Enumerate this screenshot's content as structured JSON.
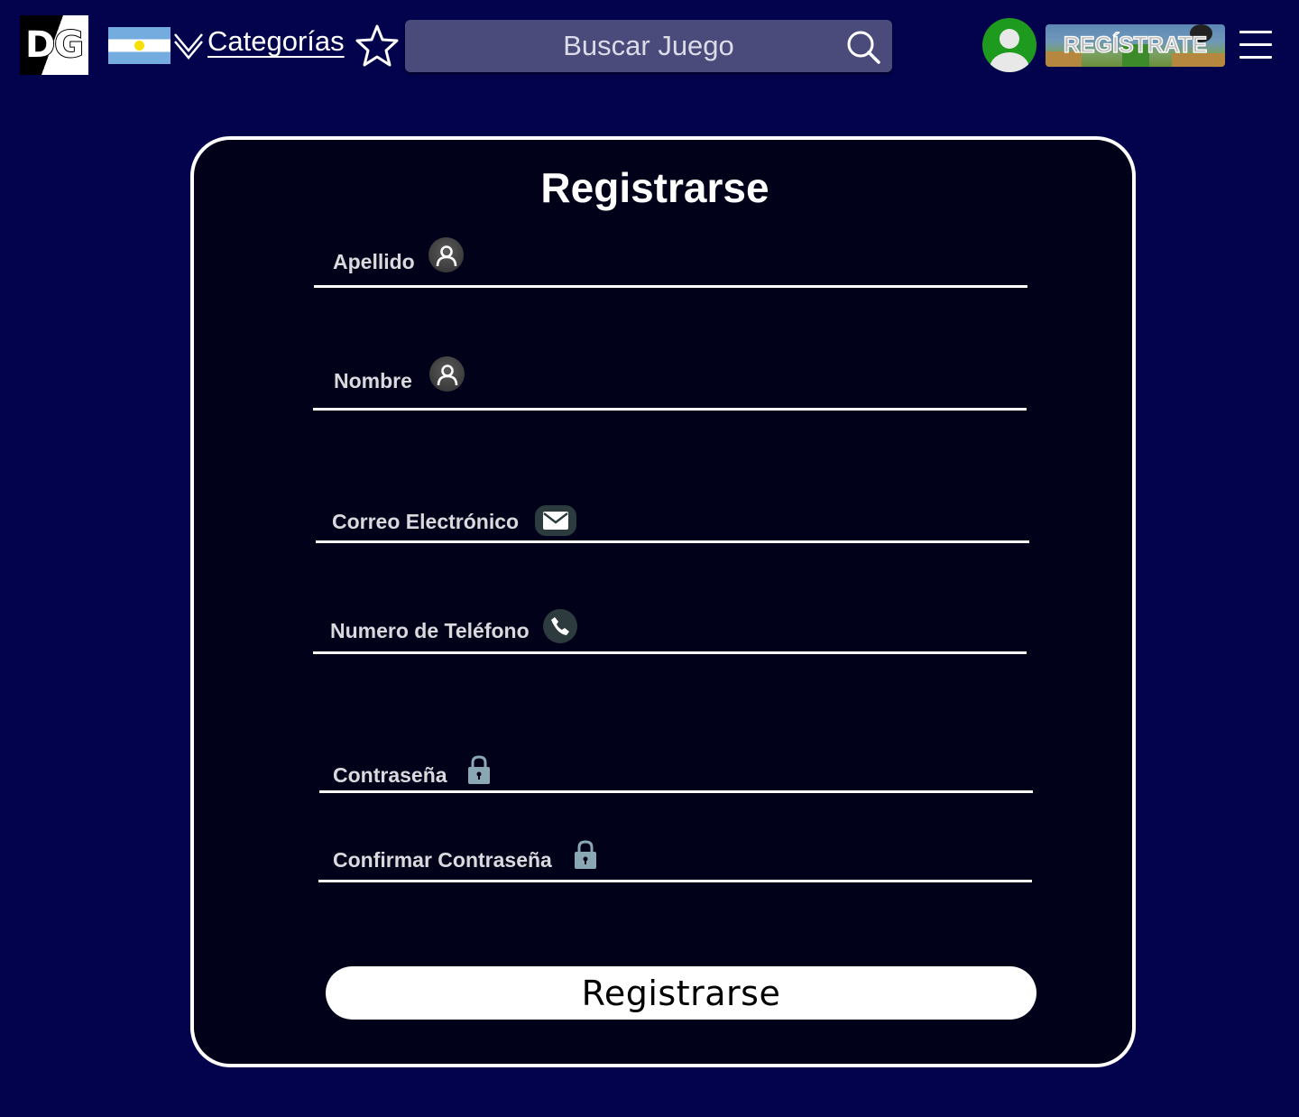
{
  "header": {
    "logo_text": "DG",
    "categories_label": "Categorías",
    "search_placeholder": "Buscar Juego",
    "register_banner_label": "REGÍSTRATE"
  },
  "form": {
    "title": "Registrarse",
    "fields": [
      {
        "label": "Apellido",
        "icon": "user-icon"
      },
      {
        "label": "Nombre",
        "icon": "user-icon"
      },
      {
        "label": "Correo Electrónico",
        "icon": "mail-icon"
      },
      {
        "label": "Numero de Teléfono",
        "icon": "phone-icon"
      },
      {
        "label": "Contraseña",
        "icon": "lock-icon"
      },
      {
        "label": "Confirmar Contraseña",
        "icon": "lock-icon"
      }
    ],
    "submit_label": "Registrarse"
  },
  "colors": {
    "page_background": "#03034d",
    "card_background": "#01011a",
    "search_background": "#4a4b7b",
    "avatar_green": "#1e9b1e"
  }
}
